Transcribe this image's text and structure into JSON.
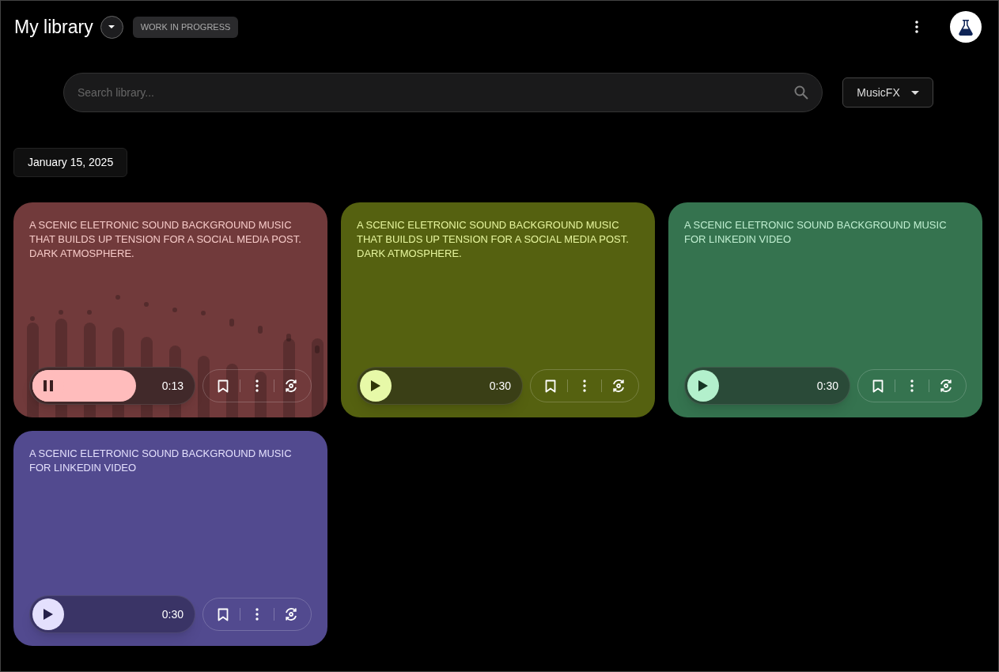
{
  "header": {
    "title": "My library",
    "badge": "WORK IN PROGRESS"
  },
  "search": {
    "placeholder": "Search library..."
  },
  "filter": {
    "label": "MusicFX"
  },
  "date": "January 15, 2025",
  "tracks": [
    {
      "prompt": "A SCENIC ELETRONIC SOUND BACKGROUND MUSIC THAT BUILDS UP TENSION FOR A SOCIAL MEDIA POST. DARK ATMOSPHERE.",
      "color": "#713a3b",
      "playing": true,
      "level": 0.65,
      "time": "0:13"
    },
    {
      "prompt": "A SCENIC ELETRONIC SOUND BACKGROUND MUSIC THAT BUILDS UP TENSION FOR A SOCIAL MEDIA POST. DARK ATMOSPHERE.",
      "color": "#556110",
      "playing": false,
      "level": 0,
      "time": "0:30"
    },
    {
      "prompt": "A SCENIC ELETRONIC SOUND BACKGROUND MUSIC FOR LINKEDIN VIDEO",
      "color": "#35734f",
      "playing": false,
      "level": 0,
      "time": "0:30"
    },
    {
      "prompt": "A SCENIC ELETRONIC SOUND BACKGROUND MUSIC FOR LINKEDIN VIDEO",
      "color": "#524a8f",
      "playing": false,
      "level": 0,
      "time": "0:30"
    }
  ]
}
